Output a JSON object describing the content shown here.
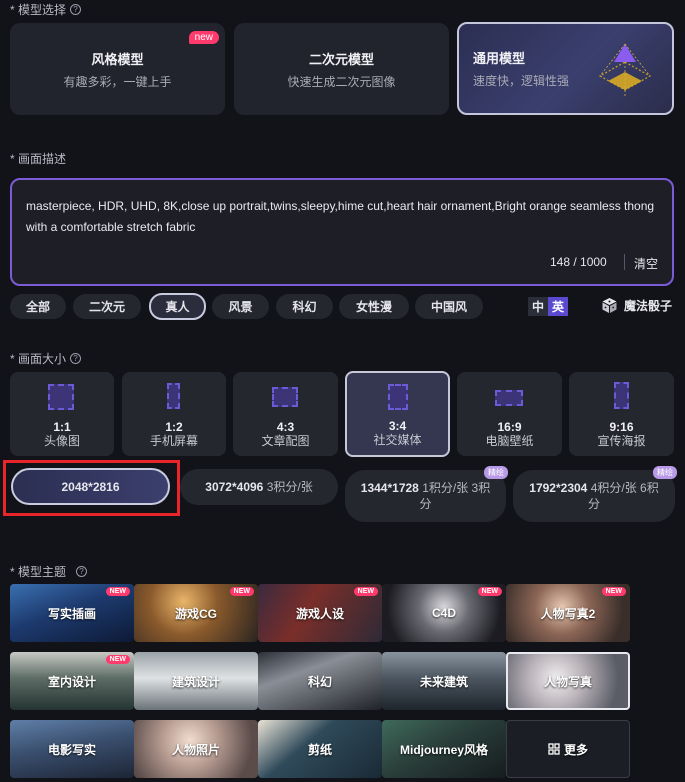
{
  "model_section": {
    "label": "* 模型选择",
    "cards": [
      {
        "title": "风格模型",
        "subtitle": "有趣多彩，一键上手",
        "badge": "new"
      },
      {
        "title": "二次元模型",
        "subtitle": "快速生成二次元图像"
      },
      {
        "title": "通用模型",
        "subtitle": "速度快，逻辑性强"
      }
    ]
  },
  "prompt_section": {
    "label": "* 画面描述",
    "text": "masterpiece, HDR, UHD, 8K,close up portrait,twins,sleepy,hime cut,heart hair ornament,Bright orange seamless thong with a comfortable stretch fabric",
    "counter": "148 / 1000",
    "clear_label": "清空"
  },
  "style_chips": [
    "全部",
    "二次元",
    "真人",
    "风景",
    "科幻",
    "女性漫",
    "中国风"
  ],
  "lang_toggle": {
    "zh": "中",
    "en": "英"
  },
  "dice_label": "魔法骰子",
  "size_section": {
    "label": "* 画面大小",
    "ratios": [
      {
        "ratio": "1:1",
        "label": "头像图"
      },
      {
        "ratio": "1:2",
        "label": "手机屏幕"
      },
      {
        "ratio": "4:3",
        "label": "文章配图"
      },
      {
        "ratio": "3:4",
        "label": "社交媒体"
      },
      {
        "ratio": "16:9",
        "label": "电脑壁纸"
      },
      {
        "ratio": "9:16",
        "label": "宣传海报"
      }
    ],
    "resolutions": [
      {
        "size": "2048*2816",
        "cost": ""
      },
      {
        "size": "3072*4096",
        "cost": "3积分/张"
      },
      {
        "size": "1344*1728",
        "cost": "1积分/张 3积",
        "cost2": "分",
        "tag": "精绘"
      },
      {
        "size": "1792*2304",
        "cost": "4积分/张 6积",
        "cost2": "分",
        "tag": "精绘"
      }
    ]
  },
  "theme_section": {
    "label": "* 模型主题",
    "tiles": [
      {
        "label": "写实插画",
        "badge": "NEW"
      },
      {
        "label": "游戏CG",
        "badge": "NEW"
      },
      {
        "label": "游戏人设",
        "badge": "NEW"
      },
      {
        "label": "C4D",
        "badge": "NEW"
      },
      {
        "label": "人物写真2",
        "badge": "NEW"
      },
      {
        "label": "室内设计",
        "badge": "NEW"
      },
      {
        "label": "建筑设计"
      },
      {
        "label": "科幻"
      },
      {
        "label": "未来建筑"
      },
      {
        "label": "人物写真"
      },
      {
        "label": "电影写实"
      },
      {
        "label": "人物照片"
      },
      {
        "label": "剪纸"
      },
      {
        "label": "Midjourney风格"
      },
      {
        "label": "更多"
      }
    ]
  },
  "colors": {
    "accent": "#7b5cd6",
    "highlight_border": "#e8262a",
    "new_badge": "#ff3b6d"
  }
}
